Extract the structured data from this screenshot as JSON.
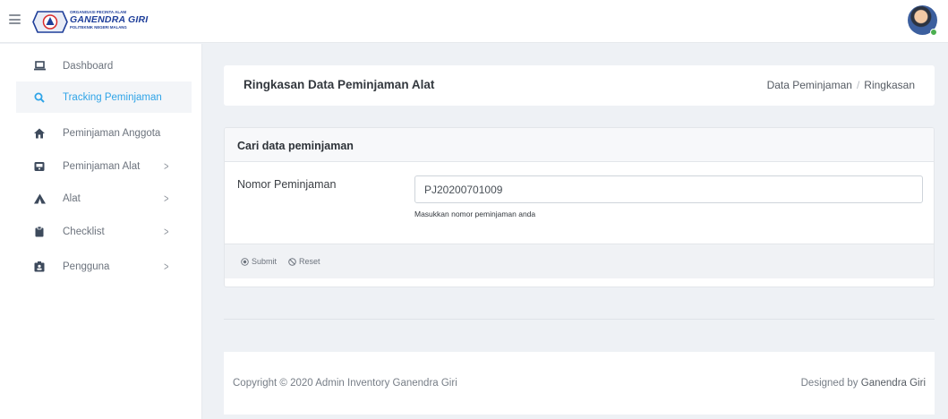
{
  "brand": {
    "org_line": "ORGANISASI PECINTA ALAM",
    "name": "GANENDRA GIRI",
    "institution": "POLITEKNIK NEGERI MALANG"
  },
  "sidebar": {
    "items": [
      {
        "label": "Dashboard",
        "icon": "laptop-icon",
        "active": false,
        "has_submenu": false
      },
      {
        "label": "Tracking Peminjaman",
        "icon": "search-icon",
        "active": true,
        "has_submenu": false
      },
      {
        "label": "Peminjaman Anggota",
        "icon": "home-icon",
        "active": false,
        "has_submenu": false
      },
      {
        "label": "Peminjaman Alat",
        "icon": "inbox-icon",
        "active": false,
        "has_submenu": true
      },
      {
        "label": "Alat",
        "icon": "tent-icon",
        "active": false,
        "has_submenu": true
      },
      {
        "label": "Checklist",
        "icon": "clipboard-icon",
        "active": false,
        "has_submenu": true
      },
      {
        "label": "Pengguna",
        "icon": "id-card-icon",
        "active": false,
        "has_submenu": true
      }
    ],
    "chevron": ">"
  },
  "header": {
    "title": "Ringkasan Data Peminjaman Alat",
    "breadcrumb": [
      "Data Peminjaman",
      "Ringkasan"
    ],
    "breadcrumb_sep": "/"
  },
  "form": {
    "card_title": "Cari data peminjaman",
    "field_label": "Nomor Peminjaman",
    "field_value": "PJ20200701009",
    "help_text": "Masukkan nomor peminjaman anda",
    "submit_label": "Submit",
    "reset_label": "Reset"
  },
  "footer": {
    "copyright": "Copyright © 2020 Admin Inventory Ganendra Giri",
    "designed_prefix": "Designed by",
    "designed_by": "Ganendra Giri"
  },
  "colors": {
    "accent": "#2fa4e7",
    "sidebar_icon": "#3d4a5c",
    "online": "#4caf50"
  }
}
